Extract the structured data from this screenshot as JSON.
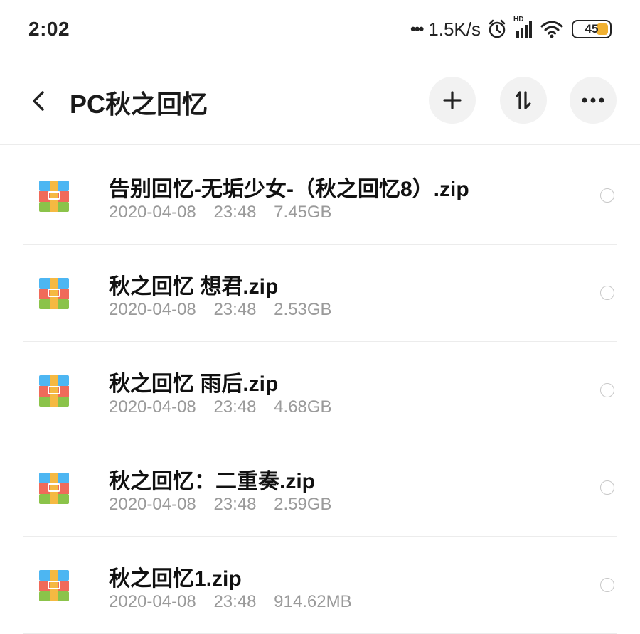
{
  "status_bar": {
    "time": "2:02",
    "dots": "•••",
    "network_speed": "1.5K/s",
    "signal_label": "HD",
    "battery_level": "45"
  },
  "header": {
    "title": "PC秋之回忆"
  },
  "files": [
    {
      "name": "告别回忆-无垢少女-（秋之回忆8）.zip",
      "date": "2020-04-08",
      "time": "23:48",
      "size": "7.45GB"
    },
    {
      "name": "秋之回忆 想君.zip",
      "date": "2020-04-08",
      "time": "23:48",
      "size": "2.53GB"
    },
    {
      "name": "秋之回忆 雨后.zip",
      "date": "2020-04-08",
      "time": "23:48",
      "size": "4.68GB"
    },
    {
      "name": "秋之回忆：二重奏.zip",
      "date": "2020-04-08",
      "time": "23:48",
      "size": "2.59GB"
    },
    {
      "name": "秋之回忆1.zip",
      "date": "2020-04-08",
      "time": "23:48",
      "size": "914.62MB"
    }
  ],
  "colors": {
    "battery_fill": "#f0b030",
    "archive_top": "#4db6f2",
    "archive_middle": "#f06a5a",
    "archive_bottom": "#8bc34a",
    "archive_band": "#f5b942"
  },
  "icons": {
    "back": "chevron-left-icon",
    "add": "plus-icon",
    "sort": "sort-icon",
    "more": "more-horizontal-icon",
    "file": "zip-archive-icon"
  }
}
